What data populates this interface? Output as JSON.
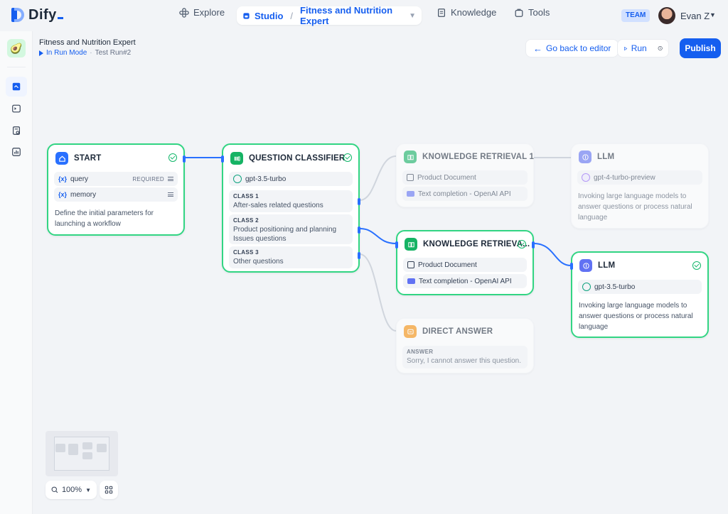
{
  "brand": {
    "name": "Dify"
  },
  "nav": {
    "explore": "Explore",
    "studio": "Studio",
    "app_name": "Fitness and Nutrition Expert",
    "knowledge": "Knowledge",
    "tools": "Tools"
  },
  "user": {
    "team_badge": "TEAM",
    "name": "Evan Z"
  },
  "header": {
    "app_title": "Fitness and Nutrition Expert",
    "run_mode": "In Run Mode",
    "separator": "·",
    "test_run": "Test Run#2",
    "back_button": "Go back to editor",
    "run_button": "Run",
    "publish_button": "Publish"
  },
  "nodes": {
    "start": {
      "title": "START",
      "variables": [
        {
          "name": "query",
          "badge": "REQUIRED"
        },
        {
          "name": "memory",
          "badge": ""
        }
      ],
      "var_symbol": "{x}",
      "description": "Define the initial parameters for launching a workflow"
    },
    "classifier": {
      "title": "QUESTION CLASSIFIER",
      "model": "gpt-3.5-turbo",
      "classes": [
        {
          "label": "CLASS 1",
          "text": "After-sales related questions"
        },
        {
          "label": "CLASS 2",
          "text": "Product positioning and planning Issues questions"
        },
        {
          "label": "CLASS 3",
          "text": "Other questions"
        }
      ]
    },
    "kr1": {
      "title": "KNOWLEDGE RETRIEVAL 1",
      "doc": "Product Document",
      "dataset": "Text completion - OpenAI API"
    },
    "kr2": {
      "title": "KNOWLEDGE RETRIEVA...",
      "doc": "Product Document",
      "dataset": "Text completion - OpenAI API"
    },
    "answer": {
      "title": "DIRECT ANSWER",
      "label": "ANSWER",
      "text": "Sorry, I cannot answer this question."
    },
    "llm1": {
      "title": "LLM",
      "model": "gpt-4-turbo-preview",
      "description": "Invoking large language models to answer questions or process natural language"
    },
    "llm2": {
      "title": "LLM",
      "model": "gpt-3.5-turbo",
      "description": "Invoking large language models to answer questions or process natural language"
    }
  },
  "zoom": {
    "level": "100%"
  },
  "colors": {
    "accent": "#155eef",
    "success": "#12b76a",
    "edge_active": "#2970ff",
    "edge_idle": "#d0d5dd"
  },
  "icons": [
    "home-icon",
    "classifier-icon",
    "book-icon",
    "llm-icon",
    "answer-icon",
    "search-icon",
    "workflow-icon"
  ]
}
